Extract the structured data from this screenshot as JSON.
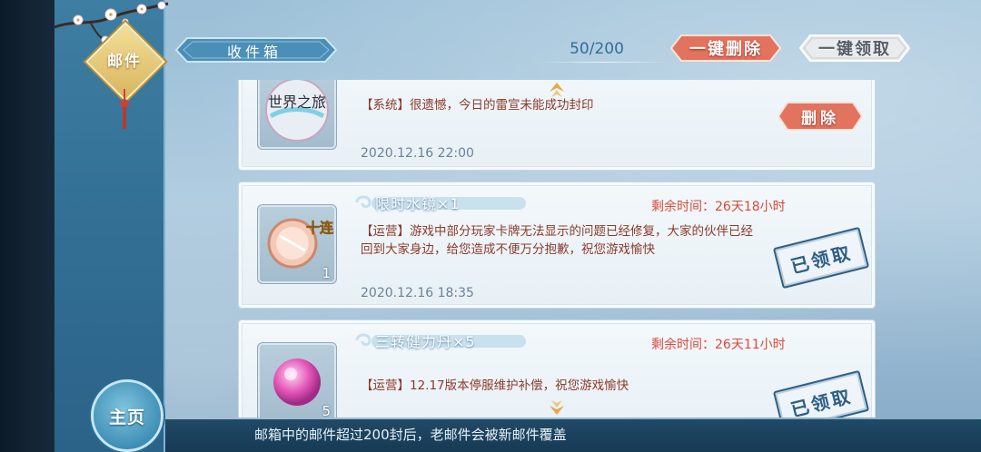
{
  "sidebar": {
    "mail_tag": "邮件",
    "home_button": "主页"
  },
  "header": {
    "title": "收件箱",
    "count": "50/200",
    "delete_all": "一键删除",
    "claim_all": "一键领取"
  },
  "mails": [
    {
      "thumb_text": "世界之旅",
      "message": "【系统】很遗憾，今日的雷宣未能成功封印",
      "date": "2020.12.16  22:00",
      "action": "删除"
    },
    {
      "item_title": "限时水镜×1",
      "remaining": "剩余时间：26天18小时",
      "thumb_badge": "十连",
      "thumb_count": "1",
      "message": "【运营】游戏中部分玩家卡牌无法显示的问题已经修复，大家的伙伴已经回到大家身边，给您造成不便万分抱歉，祝您游戏愉快",
      "date": "2020.12.16  18:35",
      "status": "已领取"
    },
    {
      "item_title": "三转健力丹×5",
      "remaining": "剩余时间：26天11小时",
      "thumb_count": "5",
      "message": "【运营】12.17版本停服维护补偿，祝您游戏愉快",
      "status": "已领取"
    }
  ],
  "footer": {
    "notice": "邮箱中的邮件超过200封后，老邮件会被新邮件覆盖"
  },
  "colors": {
    "sidebar": "#3a7aa0",
    "delete_red": "#e2735f",
    "remaining_red": "#d94a3a",
    "message_brown": "#8b3a2a",
    "stamp_blue": "#2e5f86"
  }
}
